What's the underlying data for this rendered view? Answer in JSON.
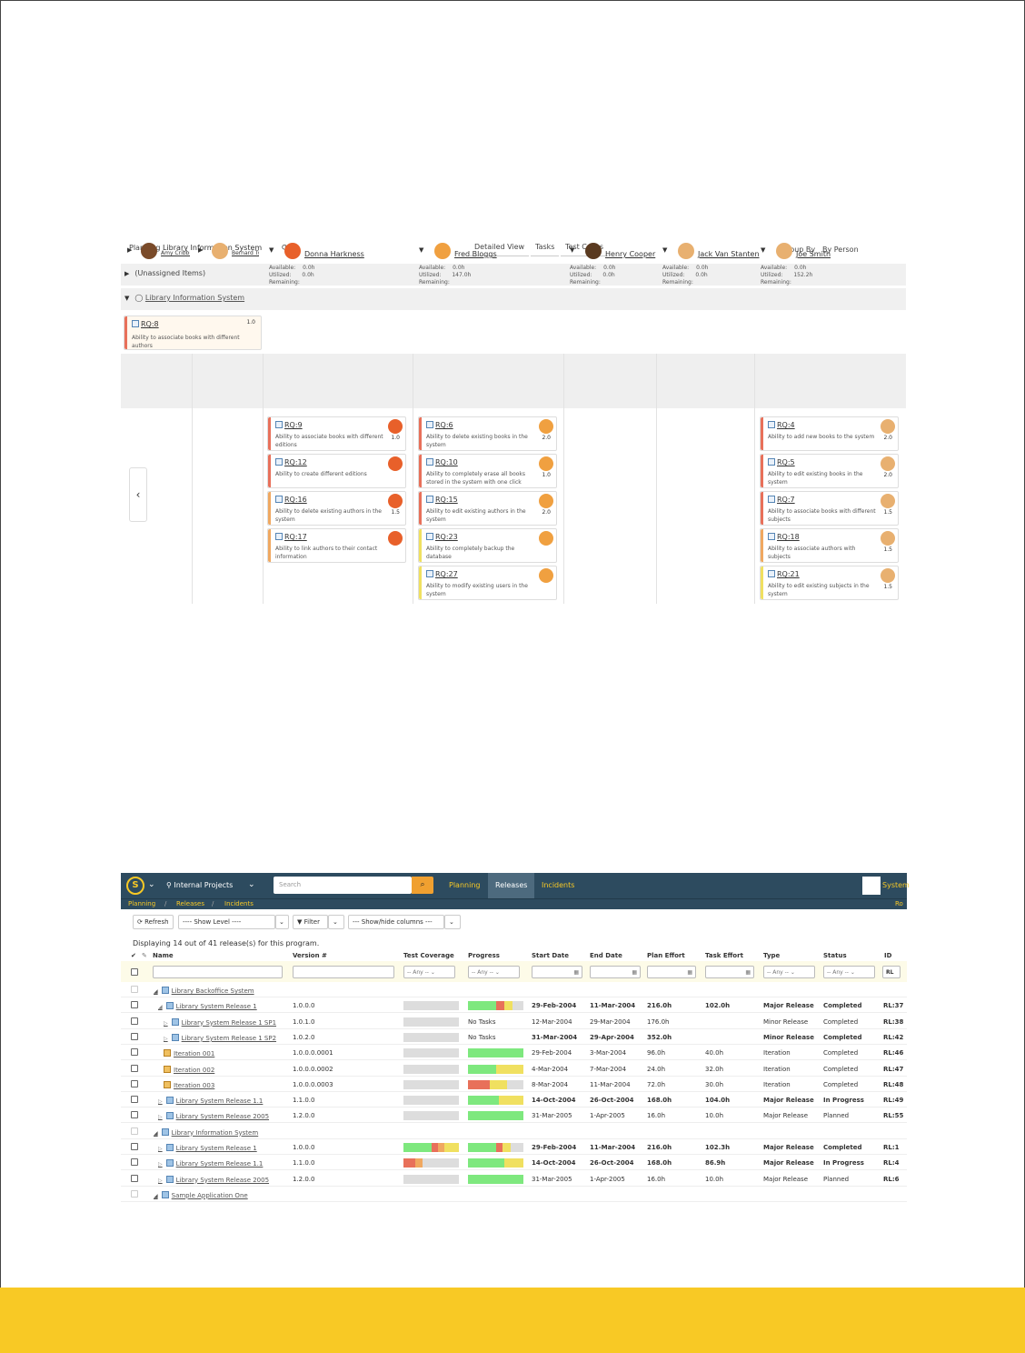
{
  "colors": {
    "accent": "#f8c925",
    "nav_bg": "#2d4b5f",
    "red": "#e8705a",
    "orange": "#f0a860",
    "yellow": "#f0e060",
    "green": "#7ee87e",
    "gray": "#dddddd"
  },
  "planning": {
    "label": "Planning",
    "project": "Library Information System",
    "tabs": [
      "Detailed View",
      "Tasks",
      "Test Cases"
    ],
    "group_by_label": "Group By",
    "group_by_value": "By Person",
    "unassigned": "(Unassigned Items)",
    "release": "Library Information System",
    "top_card": {
      "id": "RQ:8",
      "desc": "Ability to associate books with different authors",
      "est": "1.0"
    },
    "people": [
      {
        "name": "Amy Cribbins"
      },
      {
        "name": "Bernard Tyler"
      },
      {
        "name": "Donna Harkness",
        "available": "0.0h",
        "utilized": "0.0h"
      },
      {
        "name": "Fred Bloggs",
        "available": "0.0h",
        "utilized": "147.0h"
      },
      {
        "name": "Henry Cooper",
        "available": "0.0h",
        "utilized": "0.0h"
      },
      {
        "name": "Jack Van Stanten",
        "available": "0.0h",
        "utilized": "0.0h"
      },
      {
        "name": "Joe Smith",
        "available": "0.0h",
        "utilized": "152.2h"
      }
    ],
    "stat_labels": {
      "available": "Available:",
      "utilized": "Utilized:",
      "remaining": "Remaining:"
    },
    "columns": [
      {
        "cards": [
          {
            "id": "RQ:9",
            "desc": "Ability to associate books with different editions",
            "est": "1.0",
            "color": "red"
          },
          {
            "id": "RQ:12",
            "desc": "Ability to create different editions",
            "est": "",
            "color": "red"
          },
          {
            "id": "RQ:16",
            "desc": "Ability to delete existing authors in the system",
            "est": "1.5",
            "color": "orange"
          },
          {
            "id": "RQ:17",
            "desc": "Ability to link authors to their contact information",
            "est": "",
            "color": "orange"
          }
        ]
      },
      {
        "cards": [
          {
            "id": "RQ:6",
            "desc": "Ability to delete existing books in the system",
            "est": "2.0",
            "color": "red"
          },
          {
            "id": "RQ:10",
            "desc": "Ability to completely erase all books stored in the system with one click",
            "est": "1.0",
            "color": "red"
          },
          {
            "id": "RQ:15",
            "desc": "Ability to edit existing authors in the system",
            "est": "2.0",
            "color": "red"
          },
          {
            "id": "RQ:23",
            "desc": "Ability to completely backup the database",
            "est": "",
            "color": "yellow"
          },
          {
            "id": "RQ:27",
            "desc": "Ability to modify existing users in the system",
            "est": "",
            "color": "yellow"
          }
        ]
      },
      {
        "cards": [
          {
            "id": "RQ:4",
            "desc": "Ability to add new books to the system",
            "est": "2.0",
            "color": "red"
          },
          {
            "id": "RQ:5",
            "desc": "Ability to edit existing books in the system",
            "est": "2.0",
            "color": "red"
          },
          {
            "id": "RQ:7",
            "desc": "Ability to associate books with different subjects",
            "est": "1.5",
            "color": "red"
          },
          {
            "id": "RQ:18",
            "desc": "Ability to associate authors with subjects",
            "est": "1.5",
            "color": "orange"
          },
          {
            "id": "RQ:21",
            "desc": "Ability to edit existing subjects in the system",
            "est": "1.5",
            "color": "yellow"
          }
        ]
      }
    ]
  },
  "releases": {
    "nav": {
      "project": "Internal Projects",
      "search_placeholder": "Search",
      "tabs": [
        "Planning",
        "Releases",
        "Incidents"
      ],
      "user": "System",
      "sub": [
        "Planning",
        "/",
        "Releases",
        "/",
        "Incidents"
      ],
      "sub_right": "Ro"
    },
    "toolbar": {
      "refresh": "Refresh",
      "show_level": "---- Show Level ----",
      "filter": "Filter",
      "show_hide": "--- Show/hide columns ---"
    },
    "displaying": "Displaying 14 out of 41 release(s) for this program.",
    "headers": [
      "Name",
      "Version #",
      "Test Coverage",
      "Progress",
      "Start Date",
      "End Date",
      "Plan Effort",
      "Task Effort",
      "Type",
      "Status",
      "ID"
    ],
    "any": "-- Any --",
    "id_filter": "RL",
    "rows": [
      {
        "kind": "group",
        "name": "Library Backoffice System"
      },
      {
        "kind": "rel",
        "level": 1,
        "name": "Library System Release 1",
        "ver": "1.0.0.0",
        "bold": true,
        "tc": [],
        "pr": [
          [
            0.5,
            "green"
          ],
          [
            0.15,
            "red"
          ],
          [
            0.15,
            "yellow"
          ],
          [
            0.2,
            "gray"
          ]
        ],
        "notasks": "",
        "start": "29-Feb-2004",
        "end": "11-Mar-2004",
        "plan": "216.0h",
        "task": "102.0h",
        "type": "Major Release",
        "status": "Completed",
        "id": "RL:37"
      },
      {
        "kind": "rel",
        "level": 2,
        "name": "Library System Release 1 SP1",
        "ver": "1.0.1.0",
        "bold": false,
        "tc": [],
        "pr": null,
        "notasks": "No Tasks",
        "start": "12-Mar-2004",
        "end": "29-Mar-2004",
        "plan": "176.0h",
        "task": "",
        "type": "Minor Release",
        "status": "Completed",
        "id": "RL:38"
      },
      {
        "kind": "rel",
        "level": 2,
        "name": "Library System Release 1 SP2",
        "ver": "1.0.2.0",
        "bold": true,
        "tc": [],
        "pr": null,
        "notasks": "No Tasks",
        "start": "31-Mar-2004",
        "end": "29-Apr-2004",
        "plan": "352.0h",
        "task": "",
        "type": "Minor Release",
        "status": "Completed",
        "id": "RL:42"
      },
      {
        "kind": "iter",
        "level": 2,
        "name": "Iteration 001",
        "ver": "1.0.0.0.0001",
        "bold": false,
        "tc": [],
        "pr": [
          [
            1,
            "green"
          ]
        ],
        "notasks": "",
        "start": "29-Feb-2004",
        "end": "3-Mar-2004",
        "plan": "96.0h",
        "task": "40.0h",
        "type": "Iteration",
        "status": "Completed",
        "id": "RL:46"
      },
      {
        "kind": "iter",
        "level": 2,
        "name": "Iteration 002",
        "ver": "1.0.0.0.0002",
        "bold": false,
        "tc": [],
        "pr": [
          [
            0.5,
            "green"
          ],
          [
            0.5,
            "yellow"
          ]
        ],
        "notasks": "",
        "start": "4-Mar-2004",
        "end": "7-Mar-2004",
        "plan": "24.0h",
        "task": "32.0h",
        "type": "Iteration",
        "status": "Completed",
        "id": "RL:47"
      },
      {
        "kind": "iter",
        "level": 2,
        "name": "Iteration 003",
        "ver": "1.0.0.0.0003",
        "bold": false,
        "tc": [],
        "pr": [
          [
            0.4,
            "red"
          ],
          [
            0.3,
            "yellow"
          ],
          [
            0.3,
            "gray"
          ]
        ],
        "notasks": "",
        "start": "8-Mar-2004",
        "end": "11-Mar-2004",
        "plan": "72.0h",
        "task": "30.0h",
        "type": "Iteration",
        "status": "Completed",
        "id": "RL:48"
      },
      {
        "kind": "rel",
        "level": 1,
        "name": "Library System Release 1.1",
        "ver": "1.1.0.0",
        "bold": true,
        "tc": [],
        "pr": [
          [
            0.55,
            "green"
          ],
          [
            0.45,
            "yellow"
          ]
        ],
        "notasks": "",
        "start": "14-Oct-2004",
        "end": "26-Oct-2004",
        "plan": "168.0h",
        "task": "104.0h",
        "type": "Major Release",
        "status": "In Progress",
        "id": "RL:49"
      },
      {
        "kind": "rel",
        "level": 1,
        "name": "Library System Release 2005",
        "ver": "1.2.0.0",
        "bold": false,
        "tc": [],
        "pr": [
          [
            1,
            "green"
          ]
        ],
        "notasks": "",
        "start": "31-Mar-2005",
        "end": "1-Apr-2005",
        "plan": "16.0h",
        "task": "10.0h",
        "type": "Major Release",
        "status": "Planned",
        "id": "RL:55"
      },
      {
        "kind": "group",
        "name": "Library Information System"
      },
      {
        "kind": "rel",
        "level": 1,
        "name": "Library System Release 1",
        "ver": "1.0.0.0",
        "bold": true,
        "tc": [
          [
            0.5,
            "green"
          ],
          [
            0.12,
            "red"
          ],
          [
            0.12,
            "orange"
          ],
          [
            0.26,
            "yellow"
          ]
        ],
        "pr": [
          [
            0.5,
            "green"
          ],
          [
            0.12,
            "red"
          ],
          [
            0.15,
            "yellow"
          ],
          [
            0.23,
            "gray"
          ]
        ],
        "notasks": "",
        "start": "29-Feb-2004",
        "end": "11-Mar-2004",
        "plan": "216.0h",
        "task": "102.3h",
        "type": "Major Release",
        "status": "Completed",
        "id": "RL:1"
      },
      {
        "kind": "rel",
        "level": 1,
        "name": "Library System Release 1.1",
        "ver": "1.1.0.0",
        "bold": true,
        "tc": [
          [
            0.22,
            "red"
          ],
          [
            0.12,
            "orange"
          ],
          [
            0.66,
            "gray"
          ]
        ],
        "pr": [
          [
            0.65,
            "green"
          ],
          [
            0.35,
            "yellow"
          ]
        ],
        "notasks": "",
        "start": "14-Oct-2004",
        "end": "26-Oct-2004",
        "plan": "168.0h",
        "task": "86.9h",
        "type": "Major Release",
        "status": "In Progress",
        "id": "RL:4"
      },
      {
        "kind": "rel",
        "level": 1,
        "name": "Library System Release 2005",
        "ver": "1.2.0.0",
        "bold": false,
        "tc": [],
        "pr": [
          [
            1,
            "green"
          ]
        ],
        "notasks": "",
        "start": "31-Mar-2005",
        "end": "1-Apr-2005",
        "plan": "16.0h",
        "task": "10.0h",
        "type": "Major Release",
        "status": "Planned",
        "id": "RL:6"
      },
      {
        "kind": "group",
        "name": "Sample Application One"
      }
    ]
  }
}
